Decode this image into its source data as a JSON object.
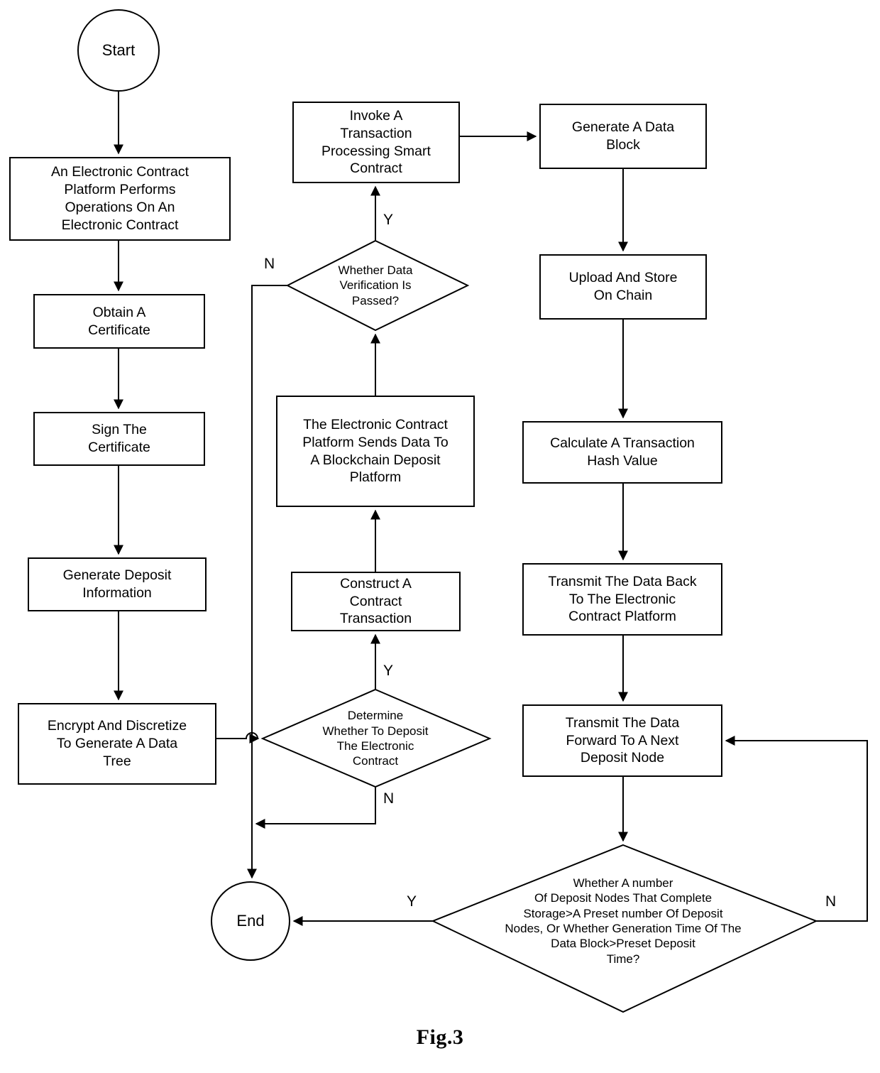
{
  "figure": {
    "caption": "Fig.3"
  },
  "diagram": {
    "type": "flowchart",
    "title": "Fig.3",
    "terminals": {
      "start": "Start",
      "end": "End"
    },
    "processes": [
      {
        "id": "p1",
        "label": "An Electronic Contract\nPlatform Performs\nOperations On An\nElectronic Contract"
      },
      {
        "id": "p2",
        "label": "Obtain A\nCertificate"
      },
      {
        "id": "p3",
        "label": "Sign The\nCertificate"
      },
      {
        "id": "p4",
        "label": "Generate Deposit\nInformation"
      },
      {
        "id": "p5",
        "label": "Encrypt And Discretize\nTo Generate A Data\nTree"
      },
      {
        "id": "p6",
        "label": "Construct A\nContract\nTransaction"
      },
      {
        "id": "p7",
        "label": "The Electronic Contract\nPlatform Sends Data To\nA Blockchain Deposit\nPlatform"
      },
      {
        "id": "p8",
        "label": "Invoke A\nTransaction\nProcessing Smart\nContract"
      },
      {
        "id": "p9",
        "label": "Generate A Data\nBlock"
      },
      {
        "id": "p10",
        "label": "Upload And Store\nOn Chain"
      },
      {
        "id": "p11",
        "label": "Calculate A Transaction\nHash Value"
      },
      {
        "id": "p12",
        "label": "Transmit The Data Back\nTo The Electronic\nContract Platform"
      },
      {
        "id": "p13",
        "label": "Transmit The Data\nForward To A Next\nDeposit Node"
      }
    ],
    "decisions": [
      {
        "id": "d1",
        "label": "Determine\nWhether To Deposit\nThe Electronic\nContract",
        "yes_label": "Y",
        "no_label": "N"
      },
      {
        "id": "d2",
        "label": "Whether Data\nVerification Is\nPassed?",
        "yes_label": "Y",
        "no_label": "N"
      },
      {
        "id": "d3",
        "label": "Whether A number\nOf Deposit Nodes That Complete\nStorage>A Preset number Of Deposit\nNodes, Or Whether Generation Time Of The\nData Block>Preset Deposit\nTime?",
        "yes_label": "Y",
        "no_label": "N"
      }
    ],
    "edge_labels": {
      "d1_yes": "Y",
      "d1_no": "N",
      "d2_yes": "Y",
      "d2_no": "N",
      "d3_yes": "Y",
      "d3_no": "N"
    },
    "colors": {
      "stroke": "#000000",
      "fill": "#ffffff",
      "text": "#000000"
    }
  }
}
